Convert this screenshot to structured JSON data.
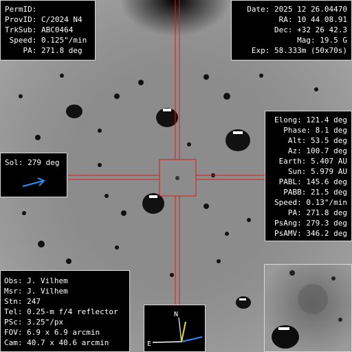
{
  "top_left": [
    "PermID:",
    "ProvID: C/2024 N4",
    "TrkSub: ABC0464",
    " Speed: 0.125\"/min",
    "    PA: 271.8 deg"
  ],
  "top_right": [
    "Date: 2025 12 26.04470",
    "RA: 10 44 08.91",
    "Dec: +32 26 42.3",
    "Mag: 19.5 G",
    "Exp: 58.333m (50x70s)"
  ],
  "right_panel": [
    "Elong: 121.4 deg",
    "Phase: 8.1 deg",
    "Alt: 53.5 deg",
    "Az: 100.7 deg",
    "Earth: 5.407 AU",
    "Sun: 5.979 AU",
    "PABL: 145.6 deg",
    "PABB: 21.5 deg",
    "Speed: 0.13\"/min",
    "PA: 271.8 deg",
    "PsAng: 279.3 deg",
    "PsAMV: 346.2 deg"
  ],
  "sol": {
    "label": "Sol: 279 deg"
  },
  "bottom_left": [
    "Obs: J. Vilhem",
    "Msr: J. Vilhem",
    "Stn: 247",
    "Tel: 0.25-m f/4 reflector",
    "PSc: 3.25\"/px",
    "FOV: 6.9 x 6.9 arcmin",
    "Cam: 40.7 x 40.6 arcmin"
  ],
  "compass": {
    "north": "N",
    "east": "E"
  },
  "colors": {
    "panel_bg": "#000000",
    "text": "#ffffff",
    "crosshair": "#e01818",
    "arrow_blue": "#1e90ff",
    "compass_yellow": "#f0e000"
  },
  "icons": {
    "sol_arrow": "sun-direction-arrow-icon",
    "compass": "compass-icon"
  }
}
